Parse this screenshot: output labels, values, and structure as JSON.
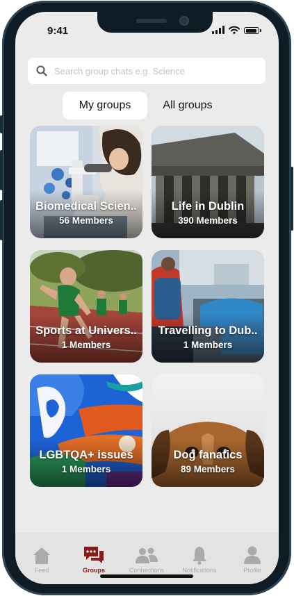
{
  "status_bar": {
    "time": "9:41"
  },
  "search": {
    "placeholder": "Search group chats e.g. Science",
    "value": ""
  },
  "segments": {
    "my_groups": "My groups",
    "all_groups": "All groups",
    "selected": "My groups"
  },
  "groups": [
    {
      "name": "Biomedical Scien..",
      "members": "56 Members"
    },
    {
      "name": "Life in Dublin",
      "members": "390 Members"
    },
    {
      "name": "Sports at Univers..",
      "members": "1 Members"
    },
    {
      "name": "Travelling to Dub..",
      "members": "1 Members"
    },
    {
      "name": "LGBTQA+ issues",
      "members": "1 Members"
    },
    {
      "name": "Dog fanatics",
      "members": "89 Members"
    }
  ],
  "tabbar": {
    "items": [
      {
        "label": "Feed",
        "icon": "home-icon"
      },
      {
        "label": "Groups",
        "icon": "chat-bubbles-icon"
      },
      {
        "label": "Connections",
        "icon": "people-icon"
      },
      {
        "label": "Notifications",
        "icon": "bell-icon"
      },
      {
        "label": "Profile",
        "icon": "person-icon"
      }
    ],
    "active": "Groups"
  },
  "colors": {
    "accent": "#8b1a1a",
    "background": "#ebebeb",
    "tab_inactive": "#aaaaaa"
  }
}
